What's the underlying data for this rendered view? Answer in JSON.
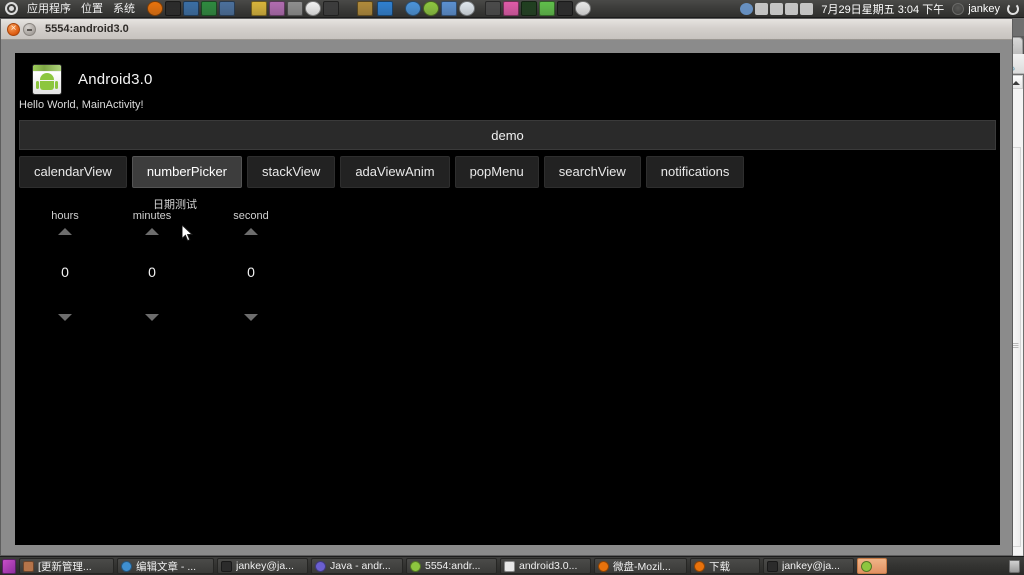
{
  "top_panel": {
    "menus": [
      "应用程序",
      "位置",
      "系统"
    ],
    "logo_icon": "ubuntu-logo-icon",
    "launcher_icons": [
      {
        "name": "firefox-icon",
        "color": "#e8720c"
      },
      {
        "name": "terminal-icon",
        "color": "#2a2a2a"
      },
      {
        "name": "screenshot-icon",
        "color": "#3a6ea5"
      },
      {
        "name": "office-calc-icon",
        "color": "#2d8a3e"
      },
      {
        "name": "gimp-icon",
        "color": "#4a6f9b"
      },
      {
        "name": "broom-cleanup-icon",
        "color": "#d8b43a"
      },
      {
        "name": "display-settings-icon",
        "color": "#b06bb0"
      },
      {
        "name": "archive-manager-icon",
        "color": "#8e8e8e"
      },
      {
        "name": "mail-icon",
        "color": "#f2f2f2"
      },
      {
        "name": "console-icon",
        "color": "#3c3c3c"
      },
      {
        "name": "workspace-switcher-icon",
        "color": "#b08a3a"
      },
      {
        "name": "bluetooth-icon",
        "color": "#2e7fd0"
      },
      {
        "name": "chrome-icon",
        "color": "#4a93d9"
      },
      {
        "name": "users-icon",
        "color": "#8dc63f"
      },
      {
        "name": "contacts-icon",
        "color": "#5a8fd0"
      },
      {
        "name": "chat-balloon-icon",
        "color": "#dfe7ee"
      },
      {
        "name": "remote-desktop-icon",
        "color": "#4a4a4a"
      },
      {
        "name": "pink-device-icon",
        "color": "#e05aa8"
      },
      {
        "name": "system-monitor-icon",
        "color": "#1f3f1f"
      },
      {
        "name": "check-monitor-icon",
        "color": "#5fbf4a"
      },
      {
        "name": "ekg-monitor-icon",
        "color": "#2b2b2b"
      },
      {
        "name": "search-icon",
        "color": "#e8e8e8"
      }
    ],
    "tray_icons": [
      {
        "name": "user-account-icon",
        "color": "#6f9fd8"
      },
      {
        "name": "wifi-icon",
        "color": "#dcdcdc"
      },
      {
        "name": "keyboard-indicator-icon",
        "color": "#dcdcdc"
      },
      {
        "name": "volume-icon",
        "color": "#dcdcdc"
      },
      {
        "name": "mail-indicator-icon",
        "color": "#dcdcdc"
      }
    ],
    "clock": "7月29日星期五 3:04 下午",
    "user": "jankey",
    "power_icon": "power-icon"
  },
  "window": {
    "title": "5554:android3.0",
    "close_icon": "close-icon",
    "minimize_icon": "minimize-icon"
  },
  "android": {
    "app_icon": "android-app-icon",
    "app_title": "Android3.0",
    "hello_text": "Hello World, MainActivity!",
    "demo_label": "demo",
    "tabs": [
      {
        "label": "calendarView",
        "active": false
      },
      {
        "label": "numberPicker",
        "active": true
      },
      {
        "label": "stackView",
        "active": false
      },
      {
        "label": "adaViewAnim",
        "active": false
      },
      {
        "label": "popMenu",
        "active": false
      },
      {
        "label": "searchView",
        "active": false
      },
      {
        "label": "notifications",
        "active": false
      }
    ],
    "picker": {
      "section_label": "日期测试",
      "columns": [
        {
          "label": "hours",
          "value": "0",
          "up_icon": "arrow-up-icon",
          "down_icon": "arrow-down-icon"
        },
        {
          "label": "minutes",
          "value": "0",
          "up_icon": "arrow-up-icon",
          "down_icon": "arrow-down-icon"
        },
        {
          "label": "second",
          "value": "0",
          "up_icon": "arrow-up-icon",
          "down_icon": "arrow-down-icon"
        }
      ]
    }
  },
  "background_window": {
    "new_tab_icon": "plus-icon",
    "wrench_icon": "wrench-icon",
    "scroll_up_icon": "scroll-up-arrow-icon",
    "scroll_down_icon": "scroll-down-arrow-icon"
  },
  "taskbar": {
    "show_desktop_icon": "show-desktop-icon",
    "trash_icon": "trash-icon",
    "items": [
      {
        "label": "[更新管理...",
        "icon": "update-manager-icon",
        "color": "#b5744a",
        "highlight": false
      },
      {
        "label": "编辑文章 - ...",
        "icon": "firefox-icon",
        "color": "#3f8fd0",
        "highlight": false
      },
      {
        "label": "jankey@ja...",
        "icon": "terminal-icon",
        "color": "#2b2b2b",
        "highlight": false
      },
      {
        "label": "Java - andr...",
        "icon": "eclipse-icon",
        "color": "#6b5fd0",
        "highlight": false
      },
      {
        "label": "5554:andr...",
        "icon": "android-icon",
        "color": "#8dc63f",
        "highlight": false
      },
      {
        "label": "android3.0...",
        "icon": "document-icon",
        "color": "#e8e8e8",
        "highlight": false
      },
      {
        "label": "微盘-Mozil...",
        "icon": "firefox-icon",
        "color": "#e8720c",
        "highlight": false
      },
      {
        "label": "下载",
        "icon": "firefox-icon",
        "color": "#e8720c",
        "highlight": false
      },
      {
        "label": "jankey@ja...",
        "icon": "terminal-icon",
        "color": "#2b2b2b",
        "highlight": false
      },
      {
        "label": "",
        "icon": "android-icon",
        "color": "#8dc63f",
        "highlight": true
      }
    ]
  }
}
